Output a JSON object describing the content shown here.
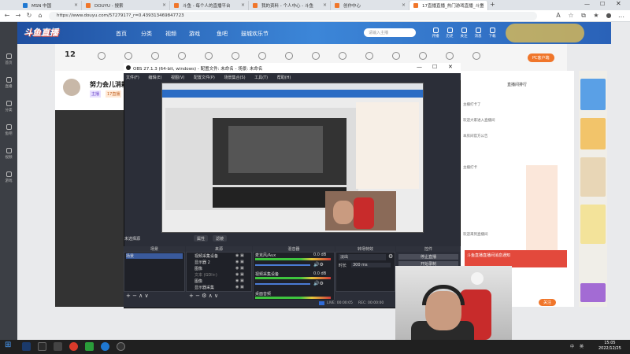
{
  "browser": {
    "tabs": [
      {
        "label": "MSN 中国",
        "active": false
      },
      {
        "label": "DOUYU - 搜索",
        "active": false
      },
      {
        "label": "斗鱼 - 每个人的直播平台",
        "active": false
      },
      {
        "label": "我的资料 - 个人中心 - 斗鱼",
        "active": false
      },
      {
        "label": "创作中心",
        "active": false
      },
      {
        "label": "17直播直播_热门游戏直播_斗鱼",
        "active": true
      }
    ],
    "url": "https://www.douyu.com/5727917?_r=0.439313469847723"
  },
  "site": {
    "logo": "斗鱼直播",
    "nav": [
      "首页",
      "分类",
      "视频",
      "游戏",
      "鱼吧",
      "鼓城欢乐节"
    ],
    "search_placeholder": "请输入主播",
    "header_icons": [
      "开播",
      "历史",
      "关注",
      "消息",
      "下载"
    ],
    "room_badge": "12",
    "streamer_name": "努力会儿消耗",
    "streamer_tags": [
      "主播",
      "17直播"
    ],
    "rail_items": [
      "首页",
      "直播",
      "分类",
      "鱼吧",
      "视频",
      "游戏"
    ],
    "pc_button": "PC客户端",
    "right_tab": "直播间排行",
    "chat": [
      "主播打卡了",
      "欢迎大家进入直播间",
      "本房间官方公告",
      "主播打卡",
      "欢迎来到直播间"
    ],
    "red_card": "斗鱼直播直播间消息通知",
    "follow_label": "关注"
  },
  "obs": {
    "title": "OBS 27.1.3 (64-bit, windows) - 配置文件: 未命名 - 场景: 未命名",
    "menu": [
      "文件(F)",
      "编辑(E)",
      "视图(V)",
      "配置文件(P)",
      "场景集合(S)",
      "工具(T)",
      "帮助(H)"
    ],
    "source_label": "未选择源",
    "prop_buttons": [
      "属性",
      "滤镜"
    ],
    "docks": {
      "scenes": {
        "title": "场景",
        "items": [
          "场景"
        ]
      },
      "sources": {
        "title": "来源",
        "items": [
          "视频采集设备",
          "显示器 2",
          "图像",
          "文本 (GDI+)",
          "图像",
          "显示器采集"
        ]
      },
      "mixer": {
        "title": "混音器",
        "channels": [
          {
            "name": "麦克风/Aux",
            "level": "0.0 dB"
          },
          {
            "name": "视频采集设备",
            "level": "0.0 dB"
          },
          {
            "name": "桌面音频",
            "level": "0.0 dB"
          }
        ]
      },
      "transitions": {
        "title": "转场特效",
        "mode": "淡出",
        "duration_label": "时长",
        "duration": "300 ms"
      },
      "controls": {
        "title": "控件",
        "buttons": [
          "停止直播",
          "开始录制",
          "工作室模式",
          "设置",
          "退出"
        ]
      }
    },
    "status": {
      "live": "LIVE: 00:00:05",
      "rec": "REC: 00:00:00",
      "cpu": "CPU: 4.1%, 60.00 fps"
    }
  },
  "taskbar": {
    "time": "15:05",
    "date": "2022/12/25",
    "tray": [
      "中",
      "英"
    ]
  },
  "colors": {
    "douyu_blue": "#2b6cc4",
    "douyu_orange": "#f0762b",
    "obs_bg": "#2b2e38"
  }
}
